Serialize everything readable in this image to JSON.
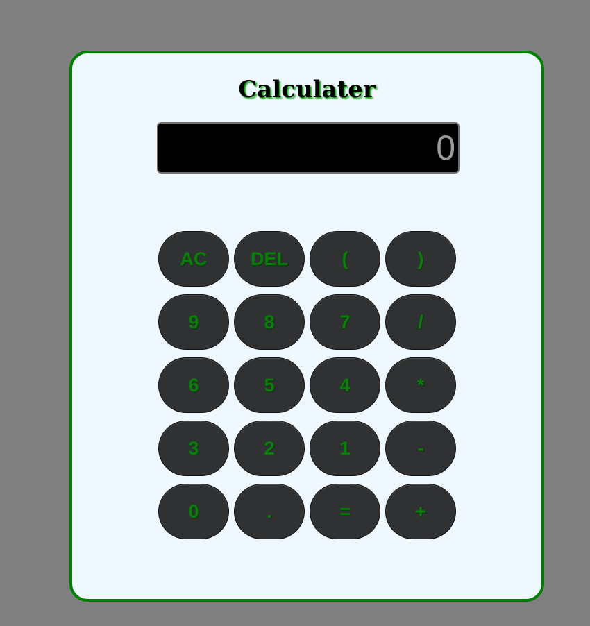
{
  "title": "Calculater",
  "display": {
    "value": "0"
  },
  "keys": [
    {
      "label": "AC"
    },
    {
      "label": "DEL"
    },
    {
      "label": "("
    },
    {
      "label": ")"
    },
    {
      "label": "9"
    },
    {
      "label": "8"
    },
    {
      "label": "7"
    },
    {
      "label": "/"
    },
    {
      "label": "6"
    },
    {
      "label": "5"
    },
    {
      "label": "4"
    },
    {
      "label": "*"
    },
    {
      "label": "3"
    },
    {
      "label": "2"
    },
    {
      "label": "1"
    },
    {
      "label": "-"
    },
    {
      "label": "0"
    },
    {
      "label": "."
    },
    {
      "label": "="
    },
    {
      "label": "+"
    }
  ],
  "colors": {
    "background": "#808080",
    "panel": "#f0f8ff",
    "border": "#008000",
    "key": "#2f3133",
    "key_text": "#0a7d0a",
    "display_bg": "#000000",
    "display_text": "#9a9a9a"
  }
}
